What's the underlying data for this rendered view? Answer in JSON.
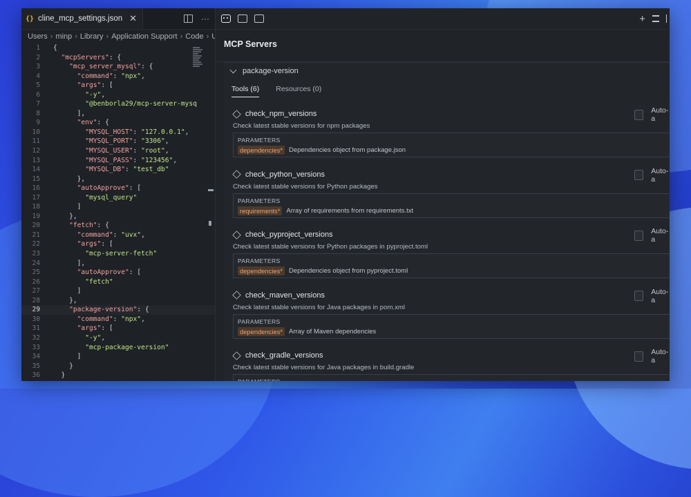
{
  "editor": {
    "tab_label": "cline_mcp_settings.json",
    "tab_icon": "{}",
    "close_glyph": "✕",
    "more_glyph": "···",
    "breadcrumbs": [
      "Users",
      "minp",
      "Library",
      "Application Support",
      "Code",
      "Use"
    ],
    "active_line": 29,
    "lines": [
      [
        [
          "p",
          "{"
        ]
      ],
      [
        [
          "p",
          "  "
        ],
        [
          "k",
          "\"mcpServers\""
        ],
        [
          "p",
          ": {"
        ]
      ],
      [
        [
          "p",
          "    "
        ],
        [
          "k",
          "\"mcp_server_mysql\""
        ],
        [
          "p",
          ": {"
        ]
      ],
      [
        [
          "p",
          "      "
        ],
        [
          "k",
          "\"command\""
        ],
        [
          "p",
          ": "
        ],
        [
          "s",
          "\"npx\""
        ],
        [
          "p",
          ","
        ]
      ],
      [
        [
          "p",
          "      "
        ],
        [
          "k",
          "\"args\""
        ],
        [
          "p",
          ": ["
        ]
      ],
      [
        [
          "p",
          "        "
        ],
        [
          "s",
          "\"-y\""
        ],
        [
          "p",
          ","
        ]
      ],
      [
        [
          "p",
          "        "
        ],
        [
          "s",
          "\"@benborla29/mcp-server-mysq"
        ]
      ],
      [
        [
          "p",
          "      ],"
        ]
      ],
      [
        [
          "p",
          "      "
        ],
        [
          "k",
          "\"env\""
        ],
        [
          "p",
          ": {"
        ]
      ],
      [
        [
          "p",
          "        "
        ],
        [
          "k",
          "\"MYSQL_HOST\""
        ],
        [
          "p",
          ": "
        ],
        [
          "s",
          "\"127.0.0.1\""
        ],
        [
          "p",
          ","
        ]
      ],
      [
        [
          "p",
          "        "
        ],
        [
          "k",
          "\"MYSQL_PORT\""
        ],
        [
          "p",
          ": "
        ],
        [
          "s",
          "\"3306\""
        ],
        [
          "p",
          ","
        ]
      ],
      [
        [
          "p",
          "        "
        ],
        [
          "k",
          "\"MYSQL_USER\""
        ],
        [
          "p",
          ": "
        ],
        [
          "s",
          "\"root\""
        ],
        [
          "p",
          ","
        ]
      ],
      [
        [
          "p",
          "        "
        ],
        [
          "k",
          "\"MYSQL_PASS\""
        ],
        [
          "p",
          ": "
        ],
        [
          "s",
          "\"123456\""
        ],
        [
          "p",
          ","
        ]
      ],
      [
        [
          "p",
          "        "
        ],
        [
          "k",
          "\"MYSQL_DB\""
        ],
        [
          "p",
          ": "
        ],
        [
          "s",
          "\"test_db\""
        ]
      ],
      [
        [
          "p",
          "      },"
        ]
      ],
      [
        [
          "p",
          "      "
        ],
        [
          "k",
          "\"autoApprove\""
        ],
        [
          "p",
          ": ["
        ]
      ],
      [
        [
          "p",
          "        "
        ],
        [
          "s",
          "\"mysql_query\""
        ]
      ],
      [
        [
          "p",
          "      ]"
        ]
      ],
      [
        [
          "p",
          "    },"
        ]
      ],
      [
        [
          "p",
          "    "
        ],
        [
          "k",
          "\"fetch\""
        ],
        [
          "p",
          ": {"
        ]
      ],
      [
        [
          "p",
          "      "
        ],
        [
          "k",
          "\"command\""
        ],
        [
          "p",
          ": "
        ],
        [
          "s",
          "\"uvx\""
        ],
        [
          "p",
          ","
        ]
      ],
      [
        [
          "p",
          "      "
        ],
        [
          "k",
          "\"args\""
        ],
        [
          "p",
          ": ["
        ]
      ],
      [
        [
          "p",
          "        "
        ],
        [
          "s",
          "\"mcp-server-fetch\""
        ]
      ],
      [
        [
          "p",
          "      ],"
        ]
      ],
      [
        [
          "p",
          "      "
        ],
        [
          "k",
          "\"autoApprove\""
        ],
        [
          "p",
          ": ["
        ]
      ],
      [
        [
          "p",
          "        "
        ],
        [
          "s",
          "\"fetch\""
        ]
      ],
      [
        [
          "p",
          "      ]"
        ]
      ],
      [
        [
          "p",
          "    },"
        ]
      ],
      [
        [
          "p",
          "    "
        ],
        [
          "k",
          "\"package-version\""
        ],
        [
          "p",
          ": {"
        ]
      ],
      [
        [
          "p",
          "      "
        ],
        [
          "k",
          "\"command\""
        ],
        [
          "p",
          ": "
        ],
        [
          "s",
          "\"npx\""
        ],
        [
          "p",
          ","
        ]
      ],
      [
        [
          "p",
          "      "
        ],
        [
          "k",
          "\"args\""
        ],
        [
          "p",
          ": ["
        ]
      ],
      [
        [
          "p",
          "        "
        ],
        [
          "s",
          "\"-y\""
        ],
        [
          "p",
          ","
        ]
      ],
      [
        [
          "p",
          "        "
        ],
        [
          "s",
          "\"mcp-package-version\""
        ]
      ],
      [
        [
          "p",
          "      ]"
        ]
      ],
      [
        [
          "p",
          "    }"
        ]
      ],
      [
        [
          "p",
          "  }"
        ]
      ],
      [
        [
          "p",
          "}"
        ]
      ]
    ]
  },
  "panel": {
    "title": "MCP Servers",
    "server_name": "package-version",
    "tabs": [
      "Tools (6)",
      "Resources (0)"
    ],
    "add_glyph": "+",
    "auto_label": "Auto-a",
    "params_header": "PARAMETERS",
    "tools": [
      {
        "name": "check_npm_versions",
        "desc": "Check latest stable versions for npm packages",
        "param": "dependencies*",
        "param_desc": "Dependencies object from package.json"
      },
      {
        "name": "check_python_versions",
        "desc": "Check latest stable versions for Python packages",
        "param": "requirements*",
        "param_desc": "Array of requirements from requirements.txt"
      },
      {
        "name": "check_pyproject_versions",
        "desc": "Check latest stable versions for Python packages in pyproject.toml",
        "param": "dependencies*",
        "param_desc": "Dependencies object from pyproject.toml"
      },
      {
        "name": "check_maven_versions",
        "desc": "Check latest stable versions for Java packages in pom.xml",
        "param": "dependencies*",
        "param_desc": "Array of Maven dependencies"
      },
      {
        "name": "check_gradle_versions",
        "desc": "Check latest stable versions for Java packages in build.gradle",
        "param": "",
        "param_desc": ""
      }
    ]
  },
  "colors": {
    "json_key": "#f0a3a3",
    "json_string": "#c2e38f",
    "param_badge": "#e8a477"
  }
}
